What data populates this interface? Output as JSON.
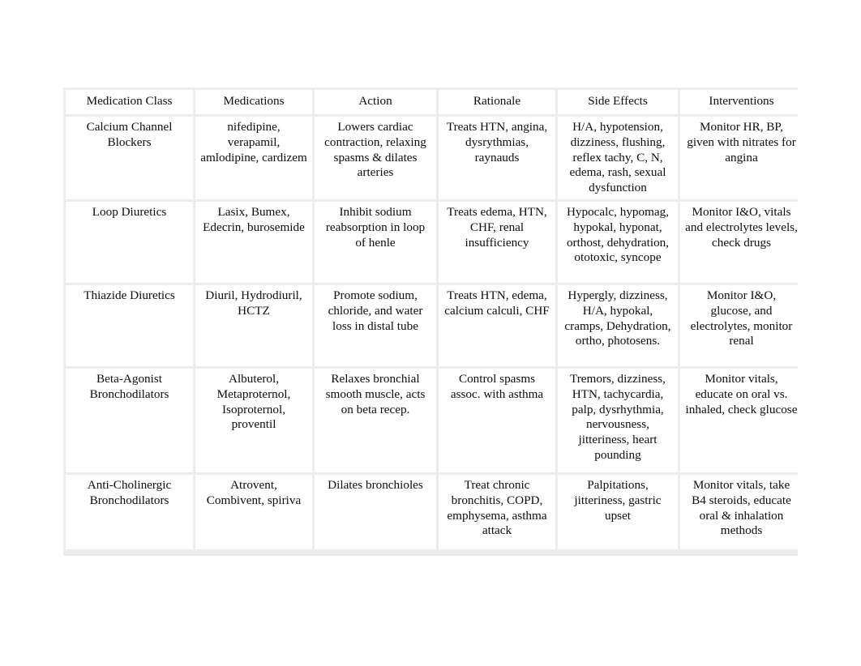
{
  "document": {
    "type": "table",
    "background_color": "#ffffff",
    "table_background_color": "#ececec",
    "cell_background_color": "#ffffff",
    "text_color": "#0d0d0d"
  },
  "table": {
    "columns": [
      "Medication Class",
      "Medications",
      "Action",
      "Rationale",
      "Side Effects",
      "Interventions"
    ],
    "rows": [
      {
        "medication_class": "Calcium Channel Blockers",
        "medications": "nifedipine, verapamil, amlodipine, cardizem",
        "action": "Lowers cardiac contraction, relaxing spasms & dilates arteries",
        "rationale": "Treats HTN, angina, dysrythmias, raynauds",
        "side_effects": "H/A, hypotension, dizziness, flushing, reflex tachy, C, N, edema, rash, sexual dysfunction",
        "interventions": "Monitor HR, BP, given with nitrates for angina"
      },
      {
        "medication_class": "Loop Diuretics",
        "medications": "Lasix, Bumex, Edecrin, burosemide",
        "action": "Inhibit sodium reabsorption in loop of henle",
        "rationale": "Treats edema, HTN, CHF, renal insufficiency",
        "side_effects": "Hypocalc, hypomag, hypokal, hyponat, orthost, dehydration, ototoxic, syncope",
        "interventions": "Monitor I&O, vitals and electrolytes levels, check drugs"
      },
      {
        "medication_class": "Thiazide Diuretics",
        "medications": "Diuril, Hydrodiuril, HCTZ",
        "action": "Promote sodium, chloride, and water loss in distal tube",
        "rationale": "Treats HTN, edema, calcium calculi, CHF",
        "side_effects": "Hypergly, dizziness, H/A, hypokal, cramps, Dehydration, ortho, photosens.",
        "interventions": "Monitor I&O, glucose, and electrolytes, monitor renal"
      },
      {
        "medication_class": "Beta-Agonist Bronchodilators",
        "medications": "Albuterol, Metaproternol, Isoproternol, proventil",
        "action": "Relaxes bronchial smooth muscle, acts on beta recep.",
        "rationale": "Control spasms assoc. with asthma",
        "side_effects": "Tremors, dizziness, HTN, tachycardia, palp, dysrhythmia, nervousness, jitteriness, heart pounding",
        "interventions": "Monitor vitals, educate on oral vs. inhaled, check glucose"
      },
      {
        "medication_class": "Anti-Cholinergic Bronchodilators",
        "medications": "Atrovent, Combivent, spiriva",
        "action": "Dilates bronchioles",
        "rationale": "Treat chronic bronchitis, COPD, emphysema, asthma attack",
        "side_effects": "Palpitations, jitteriness, gastric upset",
        "interventions": "Monitor vitals, take B4 steroids, educate oral & inhalation methods"
      }
    ]
  }
}
